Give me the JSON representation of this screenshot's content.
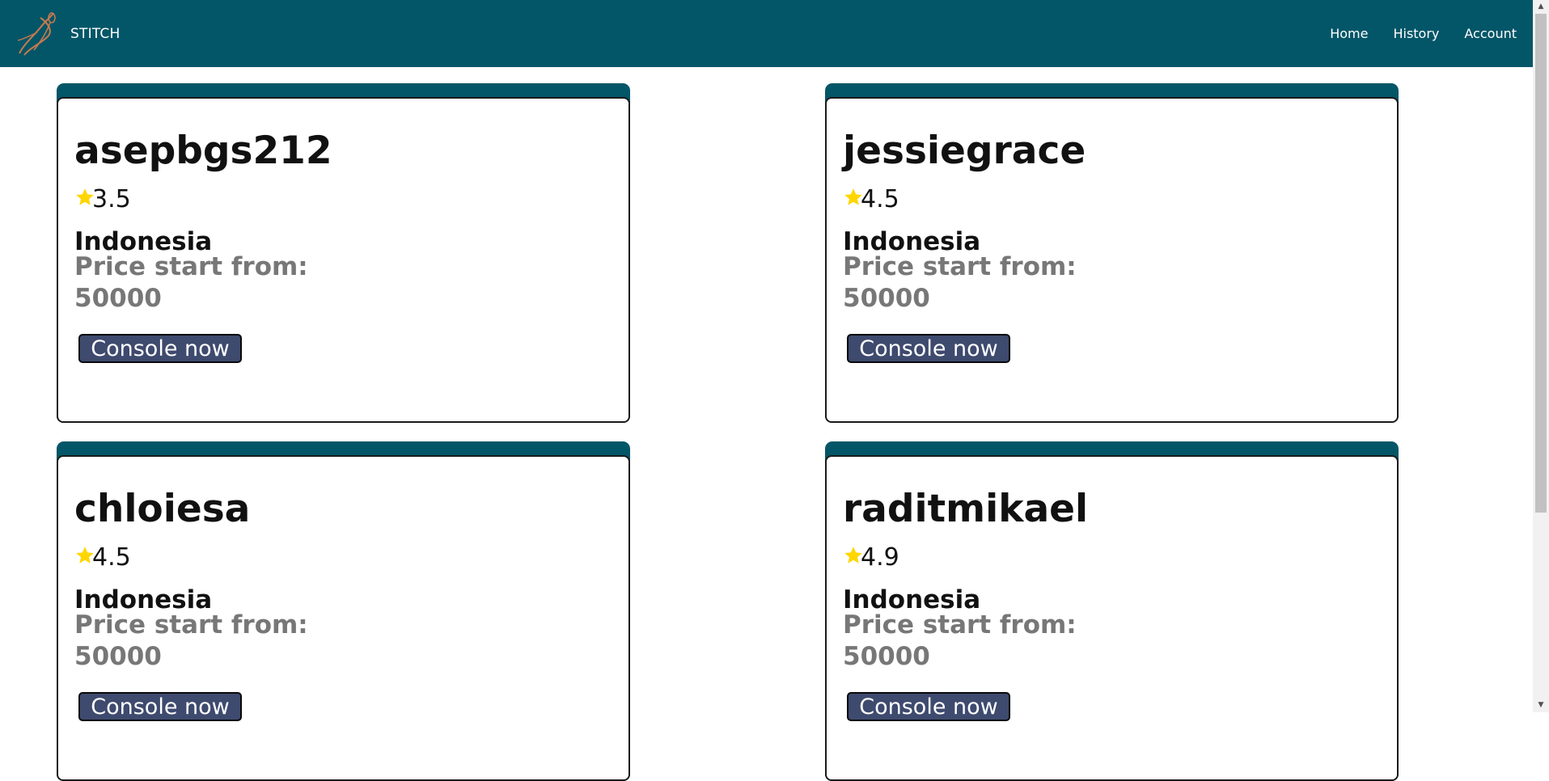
{
  "navbar": {
    "brand": "STITCH",
    "links": [
      "Home",
      "History",
      "Account"
    ]
  },
  "colors": {
    "navbar_bg": "#035668",
    "button_bg": "#3e4a6e",
    "star": "#ffd600",
    "price_text": "#777777"
  },
  "icons": {
    "logo": "needle-thread-icon",
    "rating": "star-icon"
  },
  "cards": [
    {
      "name": "asepbgs212",
      "rating": "3.5",
      "country": "Indonesia",
      "price_label": "Price start from:",
      "price": "50000",
      "button": "Console now"
    },
    {
      "name": "jessiegrace",
      "rating": "4.5",
      "country": "Indonesia",
      "price_label": "Price start from:",
      "price": "50000",
      "button": "Console now"
    },
    {
      "name": "chloiesa",
      "rating": "4.5",
      "country": "Indonesia",
      "price_label": "Price start from:",
      "price": "50000",
      "button": "Console now"
    },
    {
      "name": "raditmikael",
      "rating": "4.9",
      "country": "Indonesia",
      "price_label": "Price start from:",
      "price": "50000",
      "button": "Console now"
    }
  ]
}
